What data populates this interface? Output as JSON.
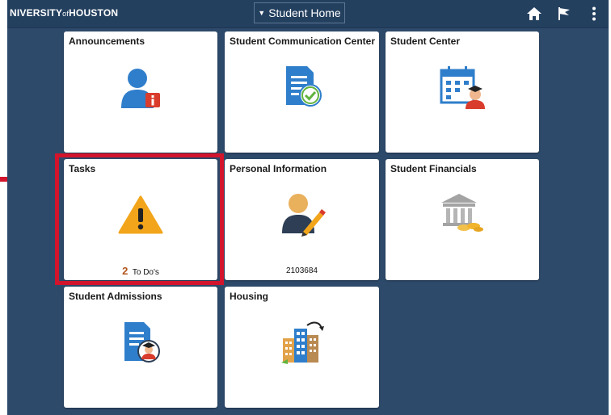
{
  "header": {
    "logo_text": "NIVERSITY",
    "logo_of": "of",
    "logo_houston": "HOUSTON",
    "page_title": "Student Home"
  },
  "tiles": [
    {
      "title": "Announcements"
    },
    {
      "title": "Student Communication Center"
    },
    {
      "title": "Student Center"
    },
    {
      "title": "Tasks",
      "count": "2",
      "count_label": "To Do's"
    },
    {
      "title": "Personal Information",
      "footer": "2103684"
    },
    {
      "title": "Student Financials"
    },
    {
      "title": "Student Admissions"
    },
    {
      "title": "Housing"
    }
  ],
  "colors": {
    "background": "#2e4a6b",
    "header": "#24405f",
    "highlight": "#d2142c",
    "icon_blue": "#2f7ecb",
    "warning": "#f2a51a"
  },
  "icons": {
    "home": "home-icon",
    "flag": "flag-icon",
    "menu": "kebab-menu-icon"
  }
}
